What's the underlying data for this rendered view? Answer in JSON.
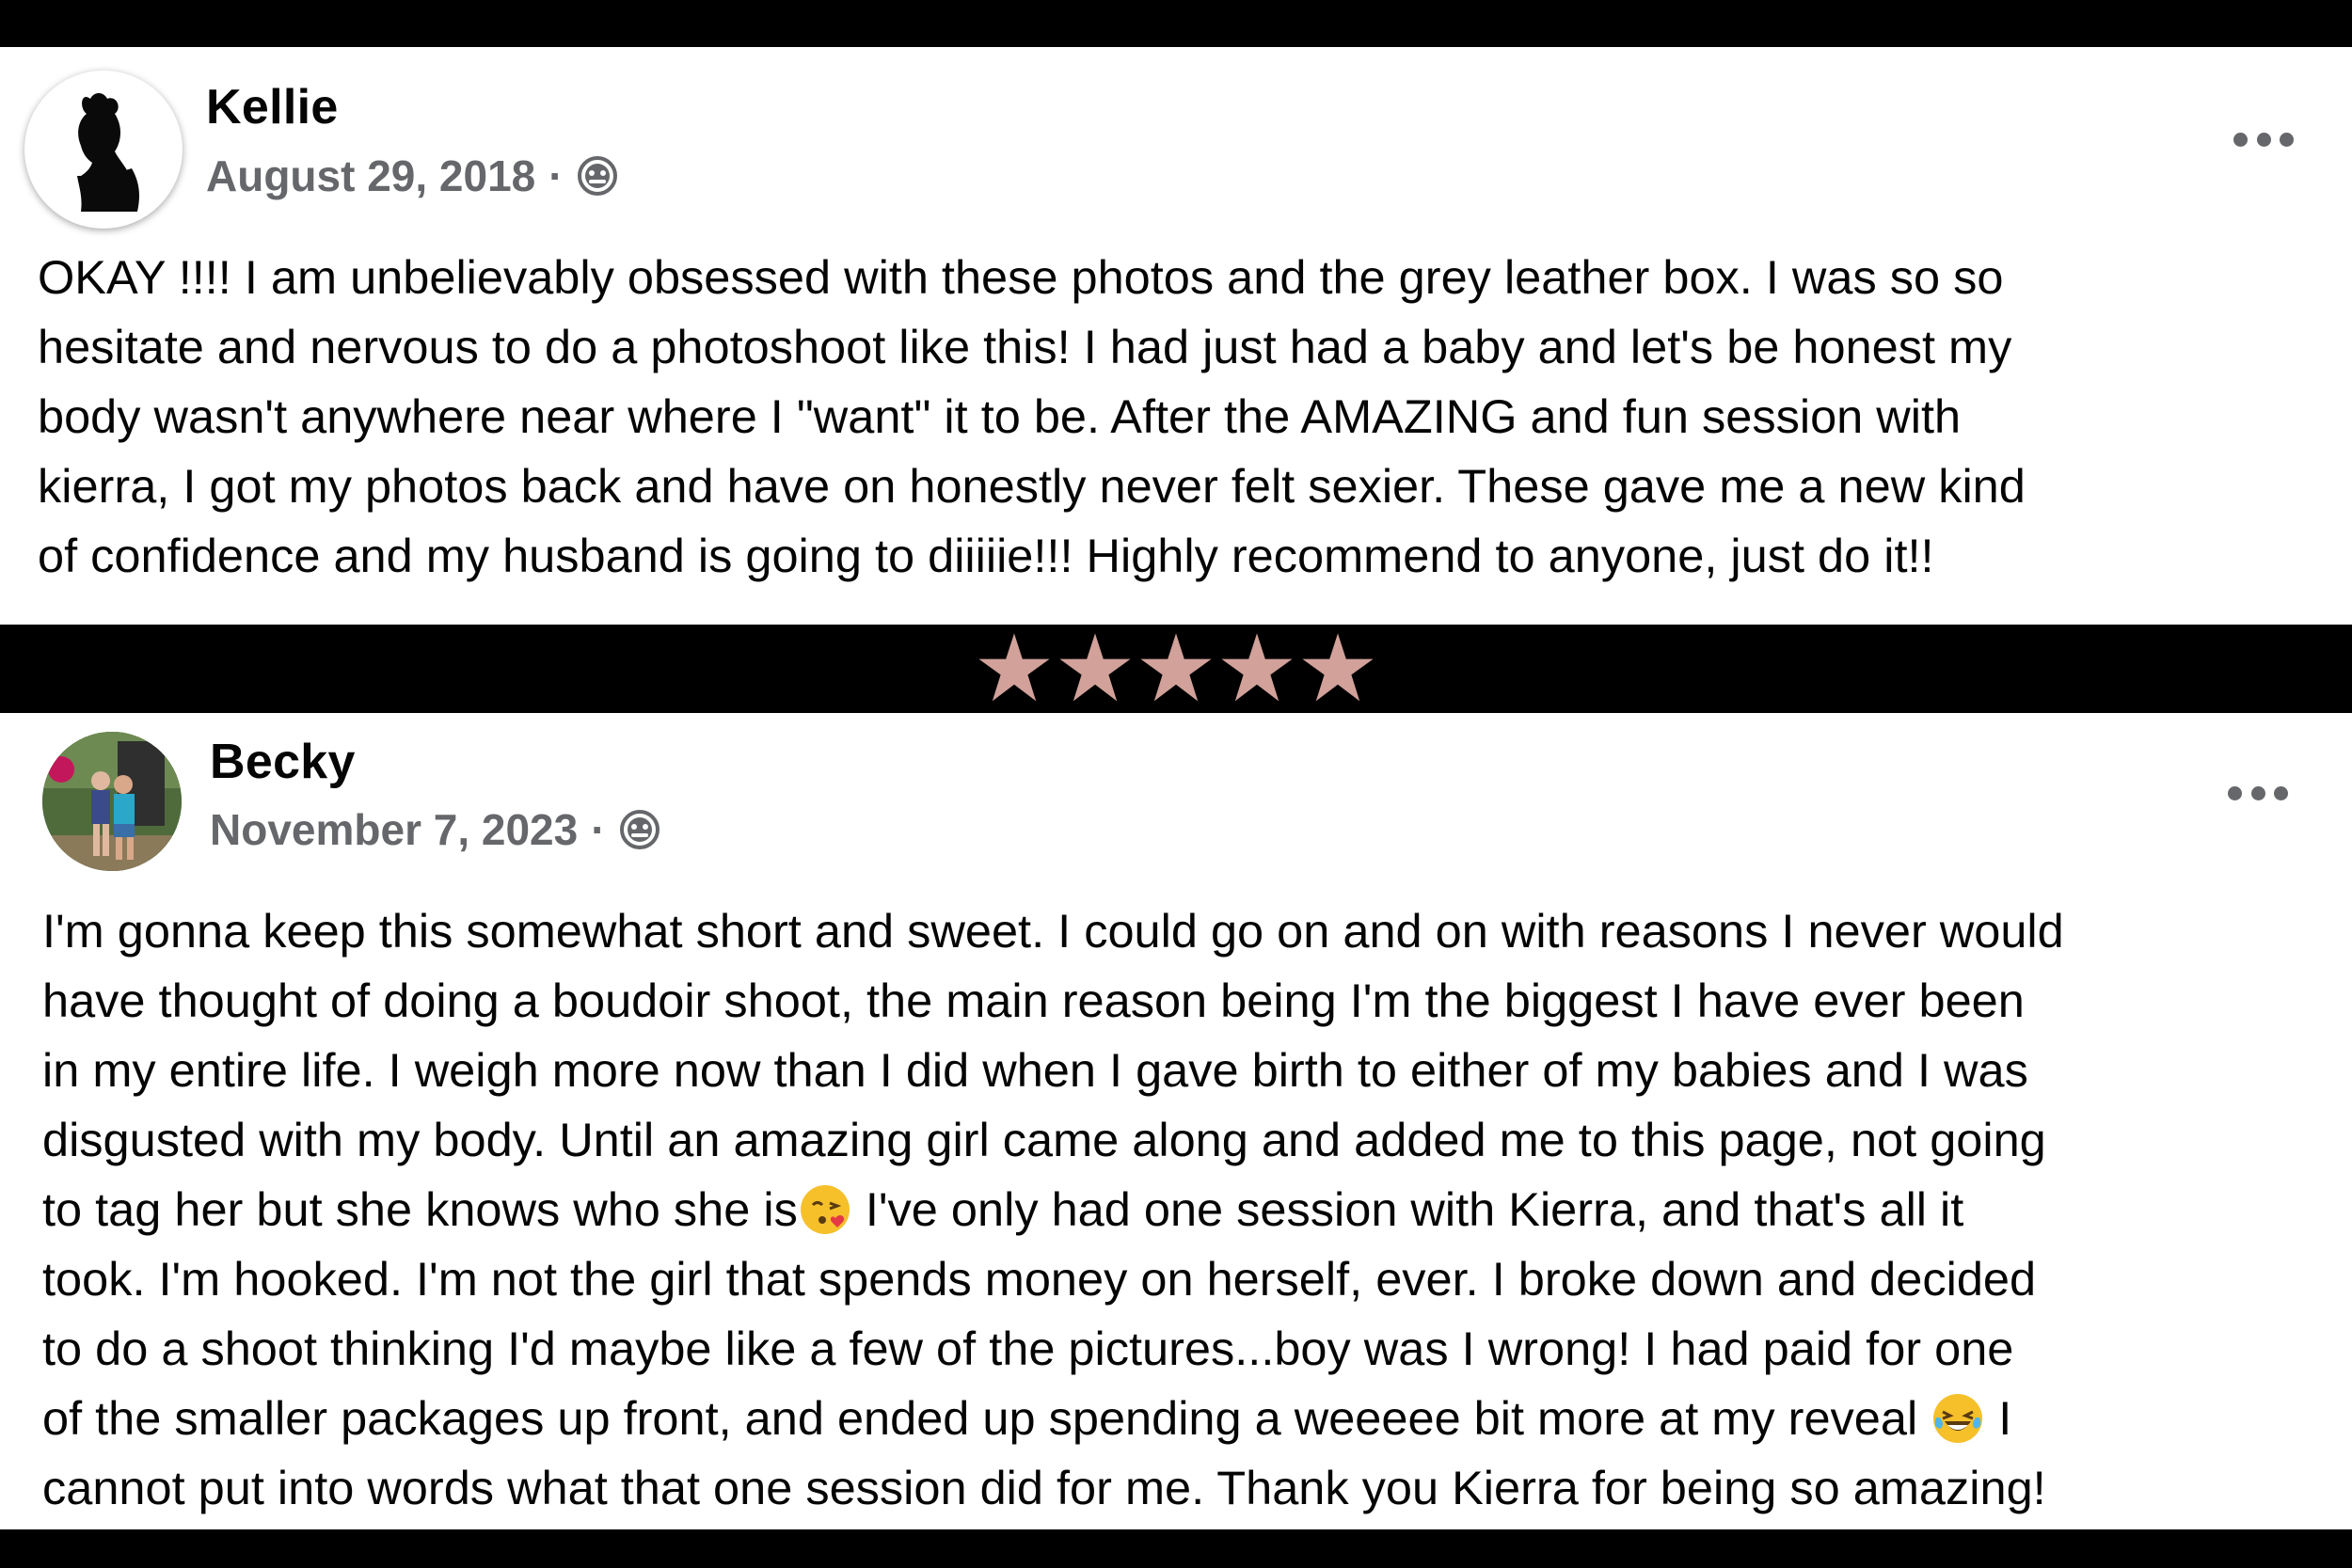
{
  "reviews": [
    {
      "name": "Kellie",
      "date": "August 29, 2018",
      "separator": "·",
      "audience_icon": "public-globe-icon",
      "text": "OKAY !!!! I am unbelievably obsessed with these photos and the grey leather box. I was so so\nhesitate and nervous to do a photoshoot like this! I had just had a baby and let's be honest my\nbody wasn't anywhere near where I \"want\" it to be. After the AMAZING and fun session with\nkierra, I got my photos back and have on honestly never felt sexier. These gave me a new kind\nof confidence and my husband is going to diiiiie!!! Highly recommend to anyone, just do it!!"
    },
    {
      "name": "Becky",
      "date": "November 7, 2023",
      "separator": "·",
      "audience_icon": "public-globe-icon",
      "text_lines": [
        "I'm gonna keep this somewhat short and sweet. I could go on and on with reasons I never would",
        "have thought of doing a boudoir shoot, the main reason being I'm the biggest I have ever been",
        "in my entire life. I weigh more now than I did when I gave birth to either of my babies and I was",
        "disgusted with my body. Until an amazing girl came along and added me to this page, not going"
      ],
      "text_line5_before_emoji": "to tag her but she knows who she is",
      "text_line5_after_emoji": " I've only had one session with Kierra, and that's all it",
      "text_lines_mid": [
        "took. I'm hooked. I'm not the girl that spends money on herself, ever. I broke down and decided",
        "to do a shoot thinking I'd maybe like a few of the pictures...boy was I wrong! I had paid for one"
      ],
      "text_line8_before_emoji": "of the smaller packages up front, and ended up spending a weeeee bit more at my reveal ",
      "text_line8_after_emoji": " I",
      "text_line9": "cannot put into words what that one session did for me. Thank you Kierra for being so amazing!"
    }
  ],
  "rating": {
    "stars": 5,
    "max": 5,
    "star_color": "#d1a19a"
  },
  "icons": {
    "more": "more-options-icon",
    "emoji_kiss": "face-blowing-kiss-emoji",
    "emoji_laugh": "tears-of-joy-emoji"
  }
}
